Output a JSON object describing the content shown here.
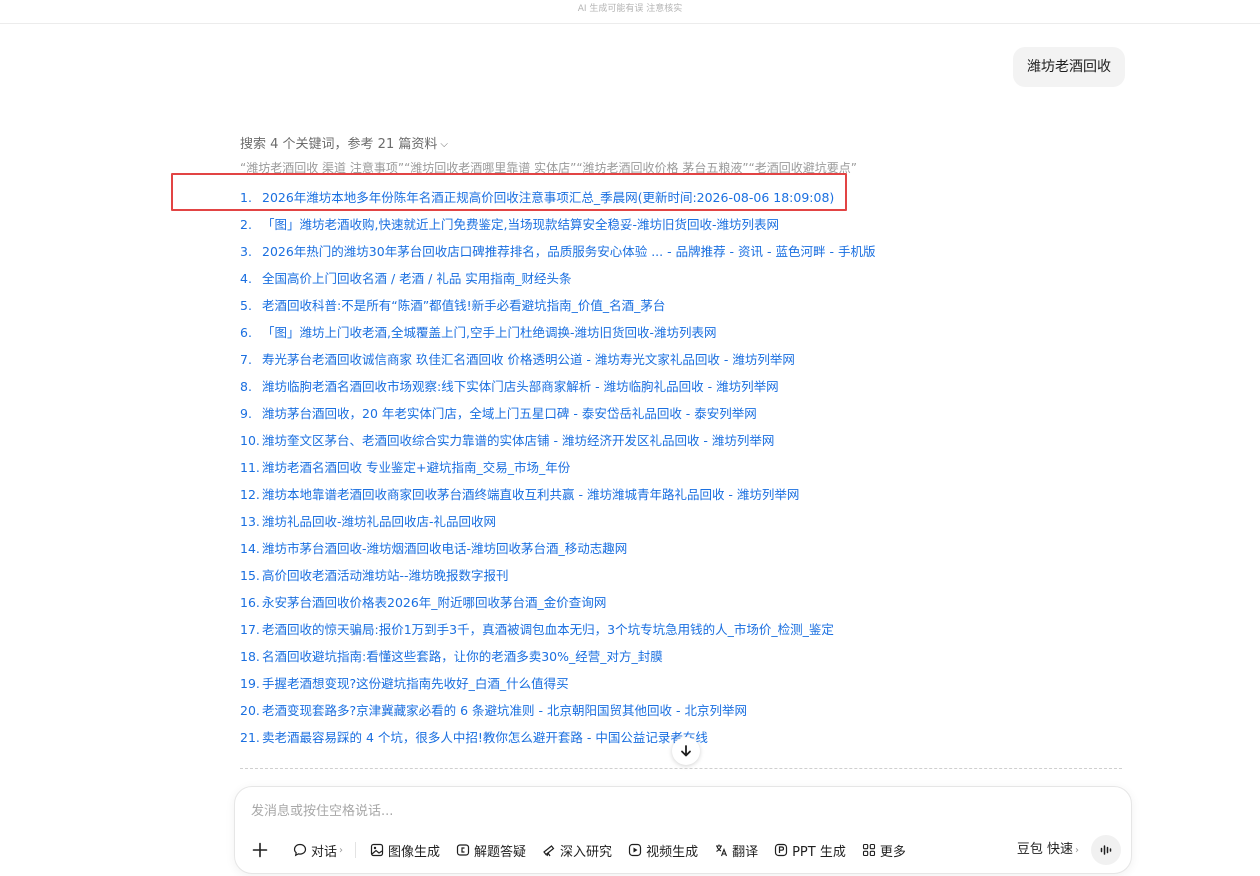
{
  "top_note": "AI 生成可能有误 注意核实",
  "user_message": "潍坊老酒回收",
  "search_summary": "搜索 4 个关键词，参考 21 篇资料",
  "keywords": "“潍坊老酒回收 渠道 注意事项”“潍坊回收老酒哪里靠谱 实体店”“潍坊老酒回收价格 茅台五粮液”“老酒回收避坑要点”",
  "references": [
    {
      "num": "1.",
      "title": "2026年潍坊本地多年份陈年名酒正规高价回收注意事项汇总_季晨网(更新时间:2026-08-06 18:09:08)"
    },
    {
      "num": "2.",
      "title": "「图」潍坊老酒收购,快速就近上门免费鉴定,当场现款结算安全稳妥-潍坊旧货回收-潍坊列表网"
    },
    {
      "num": "3.",
      "title": "2026年热门的潍坊30年茅台回收店口碑推荐排名，品质服务安心体验 ... - 品牌推荐 - 资讯 - 蓝色河畔 - 手机版"
    },
    {
      "num": "4.",
      "title": "全国高价上门回收名酒 / 老酒 / 礼品 实用指南_财经头条"
    },
    {
      "num": "5.",
      "title": "老酒回收科普:不是所有“陈酒”都值钱!新手必看避坑指南_价值_名酒_茅台"
    },
    {
      "num": "6.",
      "title": "「图」潍坊上门收老酒,全城覆盖上门,空手上门杜绝调换-潍坊旧货回收-潍坊列表网"
    },
    {
      "num": "7.",
      "title": "寿光茅台老酒回收诚信商家 玖佳汇名酒回收 价格透明公道 - 潍坊寿光文家礼品回收 - 潍坊列举网"
    },
    {
      "num": "8.",
      "title": "潍坊临朐老酒名酒回收市场观察:线下实体门店头部商家解析 - 潍坊临朐礼品回收 - 潍坊列举网"
    },
    {
      "num": "9.",
      "title": "潍坊茅台酒回收，20 年老实体门店，全域上门五星口碑 - 泰安岱岳礼品回收 - 泰安列举网"
    },
    {
      "num": "10.",
      "title": "潍坊奎文区茅台、老酒回收综合实力靠谱的实体店铺 - 潍坊经济开发区礼品回收 - 潍坊列举网"
    },
    {
      "num": "11.",
      "title": "潍坊老酒名酒回收 专业鉴定+避坑指南_交易_市场_年份"
    },
    {
      "num": "12.",
      "title": "潍坊本地靠谱老酒回收商家回收茅台酒终端直收互利共赢 - 潍坊潍城青年路礼品回收 - 潍坊列举网"
    },
    {
      "num": "13.",
      "title": "潍坊礼品回收-潍坊礼品回收店-礼品回收网"
    },
    {
      "num": "14.",
      "title": "潍坊市茅台酒回收-潍坊烟酒回收电话-潍坊回收茅台酒_移动志趣网"
    },
    {
      "num": "15.",
      "title": "高价回收老酒活动潍坊站--潍坊晚报数字报刊"
    },
    {
      "num": "16.",
      "title": "永安茅台酒回收价格表2026年_附近哪回收茅台酒_金价查询网"
    },
    {
      "num": "17.",
      "title": "老酒回收的惊天骗局:报价1万到手3千，真酒被调包血本无归，3个坑专坑急用钱的人_市场价_检测_鉴定"
    },
    {
      "num": "18.",
      "title": "名酒回收避坑指南:看懂这些套路，让你的老酒多卖30%_经营_对方_封膜"
    },
    {
      "num": "19.",
      "title": "手握老酒想变现?这份避坑指南先收好_白酒_什么值得买"
    },
    {
      "num": "20.",
      "title": "老酒变现套路多?京津冀藏家必看的 6 条避坑准则 - 北京朝阳国贸其他回收 - 北京列举网"
    },
    {
      "num": "21.",
      "title": "卖老酒最容易踩的 4 个坑，很多人中招!教你怎么避开套路 - 中国公益记录者在线"
    }
  ],
  "composer": {
    "placeholder": "发消息或按住空格说话...",
    "tools": [
      {
        "label": "对话",
        "icon": "chat-bubble-icon",
        "has_caret": true
      },
      {
        "label": "图像生成",
        "icon": "image-icon"
      },
      {
        "label": "解题答疑",
        "icon": "solve-icon"
      },
      {
        "label": "深入研究",
        "icon": "telescope-icon"
      },
      {
        "label": "视频生成",
        "icon": "video-icon"
      },
      {
        "label": "翻译",
        "icon": "translate-icon"
      },
      {
        "label": "PPT 生成",
        "icon": "ppt-icon"
      },
      {
        "label": "更多",
        "icon": "grid-icon"
      }
    ],
    "model_label": "豆包 快速",
    "caret": "›",
    "search_caret": "⌵"
  },
  "accent_colors": {
    "link": "#1a6fe0",
    "highlight_box": "#e24444"
  }
}
